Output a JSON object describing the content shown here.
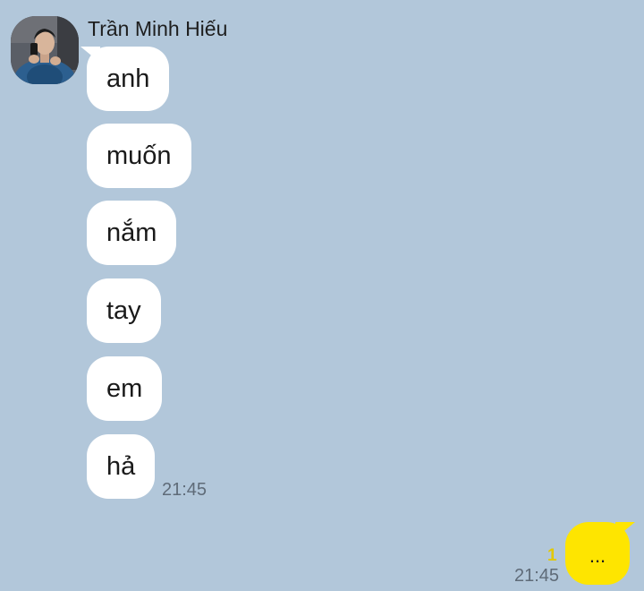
{
  "chat": {
    "sender": {
      "name": "Trần Minh Hiếu"
    },
    "incoming_messages": [
      {
        "text": "anh"
      },
      {
        "text": "muốn"
      },
      {
        "text": "nắm"
      },
      {
        "text": "tay"
      },
      {
        "text": "em"
      },
      {
        "text": "hả"
      }
    ],
    "incoming_time": "21:45",
    "outgoing_message": {
      "text": "...",
      "unread_count": "1",
      "time": "21:45"
    }
  },
  "colors": {
    "background": "#b2c7da",
    "incoming_bubble": "#ffffff",
    "outgoing_bubble": "#fee500",
    "unread_indicator": "#e2c800",
    "timestamp": "#5f6b78"
  },
  "icons": {
    "avatar": "profile-photo"
  }
}
